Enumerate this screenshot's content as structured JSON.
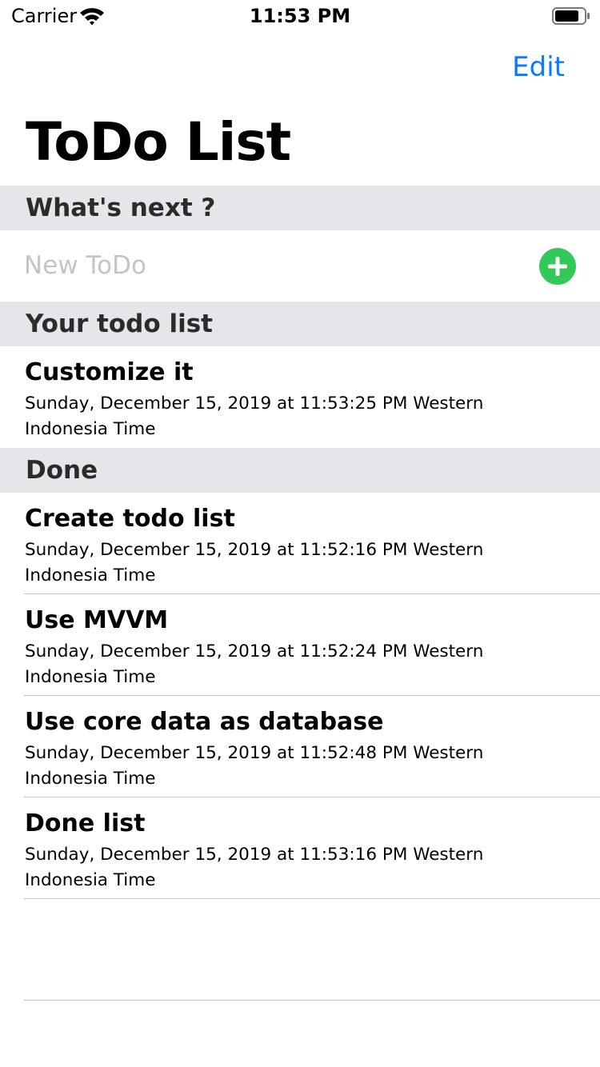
{
  "status_bar": {
    "carrier": "Carrier",
    "time": "11:53 PM"
  },
  "nav": {
    "edit_label": "Edit",
    "title": "ToDo List"
  },
  "sections": {
    "whats_next": "What's next ?",
    "your_list": "Your todo list",
    "done": "Done"
  },
  "new_todo": {
    "placeholder": "New ToDo",
    "value": ""
  },
  "todo_items": [
    {
      "title": "Customize it",
      "date": "Sunday, December 15, 2019 at 11:53:25 PM Western Indonesia Time"
    }
  ],
  "done_items": [
    {
      "title": "Create todo list",
      "date": "Sunday, December 15, 2019 at 11:52:16 PM Western Indonesia Time"
    },
    {
      "title": "Use MVVM",
      "date": "Sunday, December 15, 2019 at 11:52:24 PM Western Indonesia Time"
    },
    {
      "title": "Use core data as database",
      "date": "Sunday, December 15, 2019 at 11:52:48 PM Western Indonesia Time"
    },
    {
      "title": "Done list",
      "date": "Sunday, December 15, 2019 at 11:53:16 PM Western Indonesia Time"
    }
  ],
  "colors": {
    "accent": "#0a7aff",
    "add_button": "#34c759",
    "section_background": "#e5e5ea",
    "placeholder": "#c4c4c6"
  },
  "icons": {
    "signal": "wifi-icon",
    "battery": "battery-icon",
    "add": "add-circle-icon"
  }
}
